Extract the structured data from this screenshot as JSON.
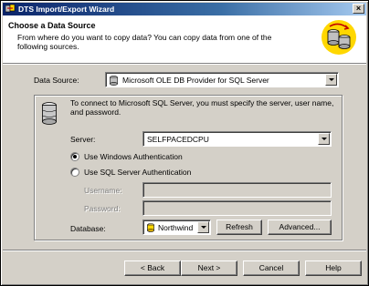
{
  "window": {
    "title": "DTS Import/Export Wizard",
    "close_glyph": "×"
  },
  "header": {
    "title": "Choose a Data Source",
    "description": "From where do you want to copy data? You can copy data from one of the following sources."
  },
  "data_source": {
    "label": "Data Source:",
    "value": "Microsoft OLE DB Provider for SQL Server"
  },
  "group": {
    "instructions": "To connect to Microsoft SQL Server, you must specify the server, user name, and password."
  },
  "server": {
    "label": "Server:",
    "value": "SELFPACEDCPU"
  },
  "auth": {
    "windows_label": "Use Windows Authentication",
    "sql_label": "Use SQL Server Authentication",
    "selected": "windows"
  },
  "credentials": {
    "username_label": "Username:",
    "password_label": "Password:",
    "username_value": "",
    "password_value": ""
  },
  "database": {
    "label": "Database:",
    "value": "Northwind",
    "refresh_label": "Refresh",
    "advanced_label": "Advanced..."
  },
  "footer": {
    "back_label": "< Back",
    "next_label": "Next >",
    "cancel_label": "Cancel",
    "help_label": "Help"
  },
  "colors": {
    "title_gradient_start": "#0a246a",
    "title_gradient_end": "#a6caf0",
    "face": "#d4d0c8",
    "header_icon_accent": "#ffd700"
  }
}
